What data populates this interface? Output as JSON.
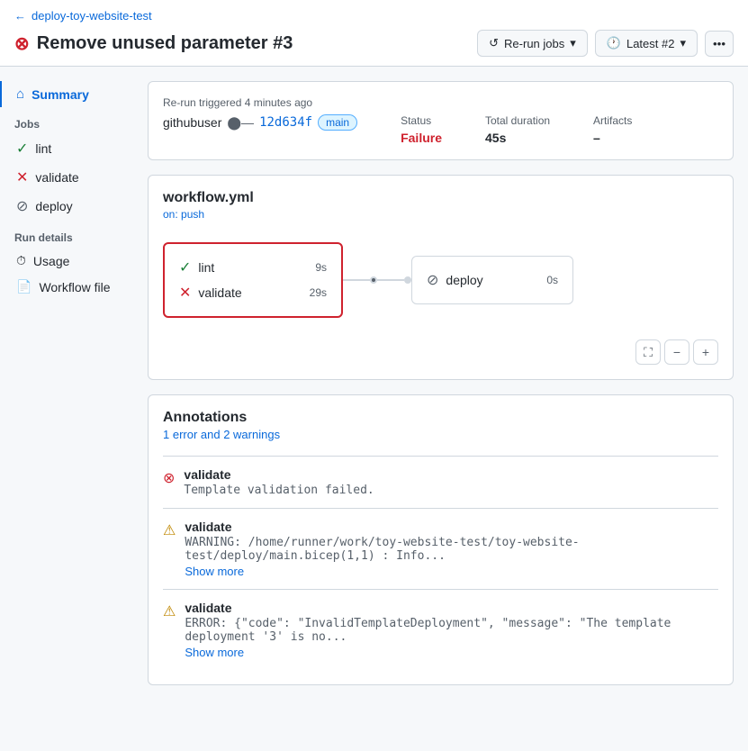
{
  "page": {
    "back_link": "deploy-toy-website-test",
    "title": "Remove unused parameter #3",
    "title_status_icon": "error-circle"
  },
  "toolbar": {
    "rerun_label": "Re-run jobs",
    "latest_label": "Latest #2",
    "more_icon": "ellipsis"
  },
  "summary": {
    "triggered_text": "Re-run triggered 4 minutes ago",
    "commit_user": "githubuser",
    "commit_hash": "12d634f",
    "commit_branch": "main",
    "status_label": "Status",
    "status_value": "Failure",
    "duration_label": "Total duration",
    "duration_value": "45s",
    "artifacts_label": "Artifacts",
    "artifacts_value": "–"
  },
  "sidebar": {
    "summary_label": "Summary",
    "jobs_section": "Jobs",
    "jobs": [
      {
        "id": "lint",
        "label": "lint",
        "status": "success"
      },
      {
        "id": "validate",
        "label": "validate",
        "status": "error"
      },
      {
        "id": "deploy",
        "label": "deploy",
        "status": "skipped"
      }
    ],
    "run_details_section": "Run details",
    "run_details_items": [
      {
        "id": "usage",
        "label": "Usage",
        "icon": "clock"
      },
      {
        "id": "workflow-file",
        "label": "Workflow file",
        "icon": "workflow"
      }
    ]
  },
  "workflow": {
    "filename": "workflow.yml",
    "trigger": "on: push",
    "jobs": [
      {
        "id": "group1",
        "selected": true,
        "tasks": [
          {
            "id": "lint",
            "label": "lint",
            "status": "success",
            "duration": "9s"
          },
          {
            "id": "validate",
            "label": "validate",
            "status": "error",
            "duration": "29s"
          }
        ]
      },
      {
        "id": "deploy",
        "label": "deploy",
        "status": "skipped",
        "duration": "0s",
        "selected": false
      }
    ],
    "controls": {
      "fullscreen_icon": "fullscreen",
      "zoom_out_icon": "minus",
      "zoom_in_icon": "plus"
    }
  },
  "annotations": {
    "title": "Annotations",
    "subtitle": "1 error and 2 warnings",
    "items": [
      {
        "id": "ann-1",
        "type": "error",
        "job": "validate",
        "message": "Template validation failed.",
        "has_more": false
      },
      {
        "id": "ann-2",
        "type": "warning",
        "job": "validate",
        "message": "WARNING: /home/runner/work/toy-website-test/toy-website-test/deploy/main.bicep(1,1) : Info...",
        "has_more": true,
        "show_more_label": "Show more"
      },
      {
        "id": "ann-3",
        "type": "warning",
        "job": "validate",
        "message": "ERROR: {\"code\": \"InvalidTemplateDeployment\", \"message\": \"The template deployment '3' is no...",
        "has_more": true,
        "show_more_label": "Show more"
      }
    ]
  }
}
